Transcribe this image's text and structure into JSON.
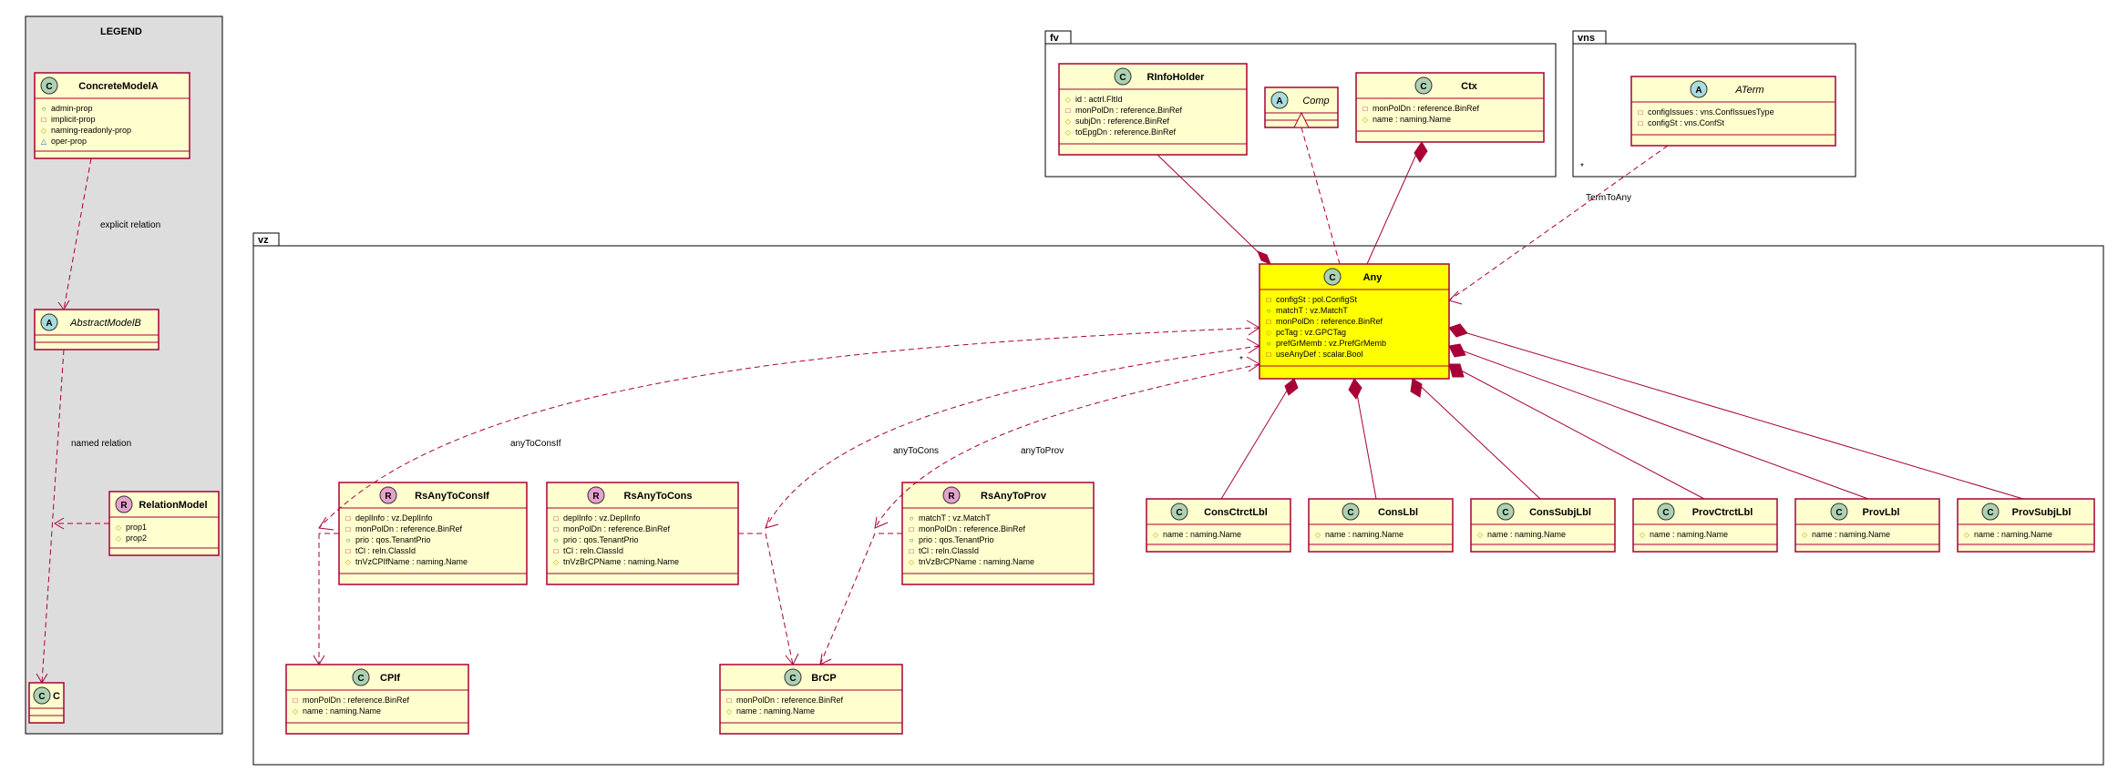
{
  "legend": {
    "title": "LEGEND",
    "concrete": {
      "name": "ConcreteModelA",
      "props": [
        {
          "g": "admin",
          "t": "admin-prop"
        },
        {
          "g": "impl",
          "t": "implicit-prop"
        },
        {
          "g": "ro",
          "t": "naming-readonly-prop"
        },
        {
          "g": "oper",
          "t": "oper-prop"
        }
      ]
    },
    "abstract": {
      "name": "AbstractModelB"
    },
    "relation": {
      "name": "RelationModel",
      "props": [
        {
          "g": "ro",
          "t": "prop1"
        },
        {
          "g": "ro",
          "t": "prop2"
        }
      ]
    },
    "c": {
      "name": "C"
    },
    "rel_explicit": "explicit relation",
    "rel_named": "named relation"
  },
  "pkg_fv": {
    "name": "fv"
  },
  "pkg_vns": {
    "name": "vns"
  },
  "pkg_vz": {
    "name": "vz"
  },
  "fv": {
    "rinfo": {
      "name": "RInfoHolder",
      "props": [
        {
          "g": "ro",
          "t": "id : actrl.FltId"
        },
        {
          "g": "impl",
          "t": "monPolDn : reference.BinRef"
        },
        {
          "g": "ro",
          "t": "subjDn : reference.BinRef"
        },
        {
          "g": "ro",
          "t": "toEpgDn : reference.BinRef"
        }
      ]
    },
    "comp": {
      "name": "Comp"
    },
    "ctx": {
      "name": "Ctx",
      "props": [
        {
          "g": "impl",
          "t": "monPolDn : reference.BinRef"
        },
        {
          "g": "ro",
          "t": "name : naming.Name"
        }
      ]
    }
  },
  "vns": {
    "aterm": {
      "name": "ATerm",
      "props": [
        {
          "g": "impl",
          "t": "configIssues : vns.ConfIssuesType"
        },
        {
          "g": "impl",
          "t": "configSt : vns.ConfSt"
        }
      ]
    }
  },
  "vz": {
    "any": {
      "name": "Any",
      "props": [
        {
          "g": "impl",
          "t": "configSt : pol.ConfigSt"
        },
        {
          "g": "admin",
          "t": "matchT : vz.MatchT"
        },
        {
          "g": "impl",
          "t": "monPolDn : reference.BinRef"
        },
        {
          "g": "ro",
          "t": "pcTag : vz.GPCTag"
        },
        {
          "g": "admin",
          "t": "prefGrMemb : vz.PrefGrMemb"
        },
        {
          "g": "impl",
          "t": "useAnyDef : scalar.Bool"
        }
      ]
    },
    "rsConsIf": {
      "name": "RsAnyToConsIf",
      "props": [
        {
          "g": "impl",
          "t": "deplInfo : vz.DeplInfo"
        },
        {
          "g": "impl",
          "t": "monPolDn : reference.BinRef"
        },
        {
          "g": "admin",
          "t": "prio : qos.TenantPrio"
        },
        {
          "g": "impl",
          "t": "tCl : reln.ClassId"
        },
        {
          "g": "ro",
          "t": "tnVzCPIfName : naming.Name"
        }
      ]
    },
    "rsCons": {
      "name": "RsAnyToCons",
      "props": [
        {
          "g": "impl",
          "t": "deplInfo : vz.DeplInfo"
        },
        {
          "g": "impl",
          "t": "monPolDn : reference.BinRef"
        },
        {
          "g": "admin",
          "t": "prio : qos.TenantPrio"
        },
        {
          "g": "impl",
          "t": "tCl : reln.ClassId"
        },
        {
          "g": "ro",
          "t": "tnVzBrCPName : naming.Name"
        }
      ]
    },
    "rsProv": {
      "name": "RsAnyToProv",
      "props": [
        {
          "g": "admin",
          "t": "matchT : vz.MatchT"
        },
        {
          "g": "impl",
          "t": "monPolDn : reference.BinRef"
        },
        {
          "g": "admin",
          "t": "prio : qos.TenantPrio"
        },
        {
          "g": "impl",
          "t": "tCl : reln.ClassId"
        },
        {
          "g": "ro",
          "t": "tnVzBrCPName : naming.Name"
        }
      ]
    },
    "cpif": {
      "name": "CPIf",
      "props": [
        {
          "g": "impl",
          "t": "monPolDn : reference.BinRef"
        },
        {
          "g": "ro",
          "t": "name : naming.Name"
        }
      ]
    },
    "brcp": {
      "name": "BrCP",
      "props": [
        {
          "g": "impl",
          "t": "monPolDn : reference.BinRef"
        },
        {
          "g": "ro",
          "t": "name : naming.Name"
        }
      ]
    },
    "consCtrctLbl": {
      "name": "ConsCtrctLbl",
      "props": [
        {
          "g": "ro",
          "t": "name : naming.Name"
        }
      ]
    },
    "consLbl": {
      "name": "ConsLbl",
      "props": [
        {
          "g": "ro",
          "t": "name : naming.Name"
        }
      ]
    },
    "consSubjLbl": {
      "name": "ConsSubjLbl",
      "props": [
        {
          "g": "ro",
          "t": "name : naming.Name"
        }
      ]
    },
    "provCtrctLbl": {
      "name": "ProvCtrctLbl",
      "props": [
        {
          "g": "ro",
          "t": "name : naming.Name"
        }
      ]
    },
    "provLbl": {
      "name": "ProvLbl",
      "props": [
        {
          "g": "ro",
          "t": "name : naming.Name"
        }
      ]
    },
    "provSubjLbl": {
      "name": "ProvSubjLbl",
      "props": [
        {
          "g": "ro",
          "t": "name : naming.Name"
        }
      ]
    }
  },
  "rels": {
    "anyToConsIf": "anyToConsIf",
    "anyToCons": "anyToCons",
    "anyToProv": "anyToProv",
    "termToAny": "TermToAny",
    "star": "*"
  }
}
